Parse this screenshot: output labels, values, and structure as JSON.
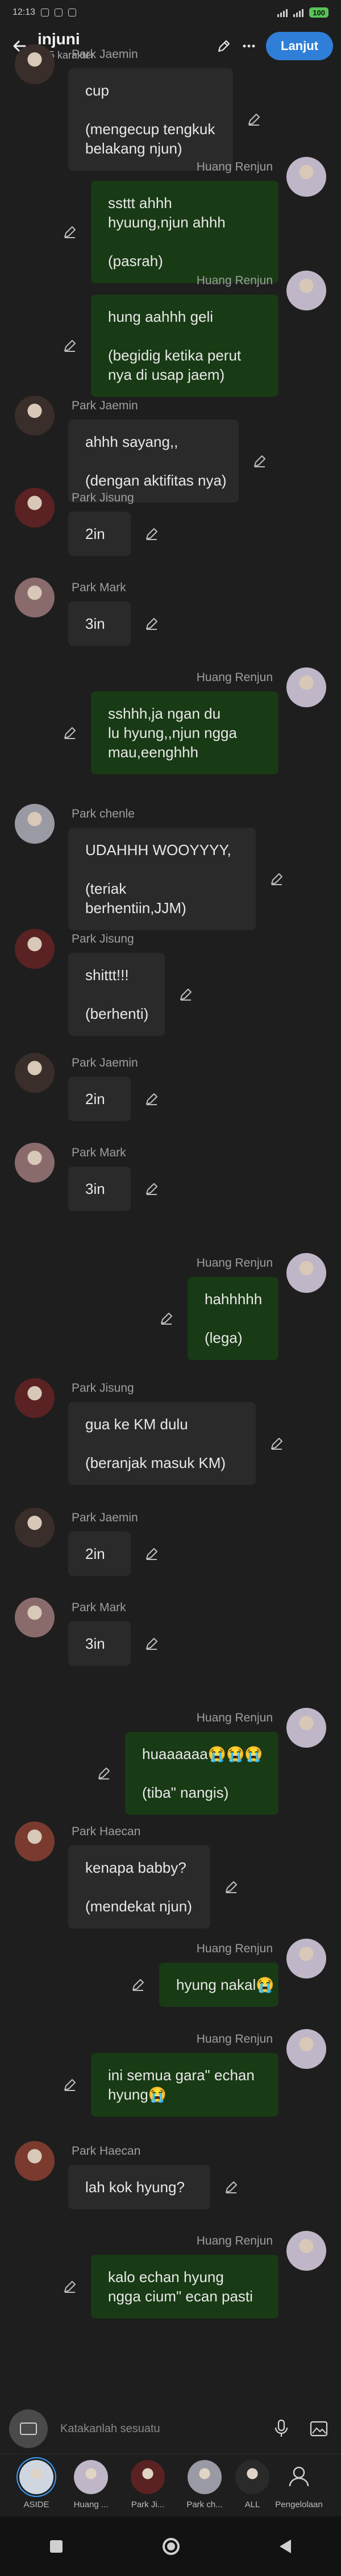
{
  "status": {
    "time": "12:13",
    "battery": "100"
  },
  "appbar": {
    "back_icon": "back-arrow-icon",
    "title": "injuni",
    "subtitle": "645 karakter",
    "edit_icon": "pencil-icon",
    "more_icon": "more-icon",
    "next_label": "Lanjut"
  },
  "colors": {
    "incoming": "#2a2a2a",
    "outgoing": "#183a14",
    "accent": "#2f7fd8"
  },
  "messages": [
    {
      "side": "in",
      "sender": "Park Jaemin",
      "lines": [
        "cup",
        "",
        "(mengecup tengkuk",
        "belakang njun)"
      ]
    },
    {
      "side": "out",
      "sender": "Huang Renjun",
      "lines": [
        "ssttt ahhh",
        "hyuung,njun ahhh",
        "",
        "(pasrah)"
      ]
    },
    {
      "side": "out",
      "sender": "Huang Renjun",
      "lines": [
        "hung aahhh geli",
        "",
        "(begidig ketika perut",
        "nya di usap jaem)"
      ]
    },
    {
      "side": "in",
      "sender": "Park Jaemin",
      "lines": [
        "ahhh sayang,,",
        "",
        "(dengan aktifitas nya)"
      ]
    },
    {
      "side": "in",
      "sender": "Park Jisung",
      "lines": [
        "2in"
      ]
    },
    {
      "side": "in",
      "sender": "Park Mark",
      "lines": [
        "3in"
      ]
    },
    {
      "side": "out",
      "sender": "Huang Renjun",
      "lines": [
        "sshhh,ja ngan du",
        "lu hyung,,njun ngga",
        "mau,eenghhh"
      ]
    },
    {
      "side": "in",
      "sender": "Park chenle",
      "lines": [
        "UDAHHH WOOYYYY,",
        "",
        "(teriak",
        "berhentiin,JJM)"
      ]
    },
    {
      "side": "in",
      "sender": "Park Jisung",
      "lines": [
        "shittt!!!",
        "",
        "(berhenti)"
      ]
    },
    {
      "side": "in",
      "sender": "Park Jaemin",
      "lines": [
        "2in"
      ]
    },
    {
      "side": "in",
      "sender": "Park Mark",
      "lines": [
        "3in"
      ]
    },
    {
      "side": "out",
      "sender": "Huang Renjun",
      "lines": [
        "hahhhhh",
        "",
        "(lega)"
      ]
    },
    {
      "side": "in",
      "sender": "Park Jisung",
      "lines": [
        "gua ke KM dulu",
        "",
        "(beranjak masuk KM)"
      ]
    },
    {
      "side": "in",
      "sender": "Park Jaemin",
      "lines": [
        "2in"
      ]
    },
    {
      "side": "in",
      "sender": "Park Mark",
      "lines": [
        "3in"
      ]
    },
    {
      "side": "out",
      "sender": "Huang Renjun",
      "lines": [
        "huaaaaaa😭😭😭",
        "",
        "(tiba\" nangis)"
      ]
    },
    {
      "side": "in",
      "sender": "Park Haecan",
      "lines": [
        "kenapa babby?",
        "",
        "(mendekat njun)"
      ]
    },
    {
      "side": "out",
      "sender": "Huang Renjun",
      "lines": [
        "hyung nakal😭"
      ]
    },
    {
      "side": "out",
      "sender": "Huang Renjun",
      "lines": [
        "ini semua gara\" echan",
        "hyung😭"
      ]
    },
    {
      "side": "in",
      "sender": "Park Haecan",
      "lines": [
        "lah kok hyung?"
      ]
    },
    {
      "side": "out",
      "sender": "Huang Renjun",
      "lines": [
        "kalo echan hyung",
        "ngga cium\" ecan pasti"
      ]
    }
  ],
  "composer": {
    "placeholder": "Katakanlah sesuatu",
    "mic_icon": "mic-icon",
    "gallery_icon": "gallery-icon",
    "add_icon": "add-media-icon"
  },
  "tabs": [
    {
      "label": "ASIDE"
    },
    {
      "label": "Huang ..."
    },
    {
      "label": "Park Ji..."
    },
    {
      "label": "Park ch..."
    },
    {
      "label": "ALL"
    },
    {
      "label": "Pengelolaan"
    }
  ]
}
